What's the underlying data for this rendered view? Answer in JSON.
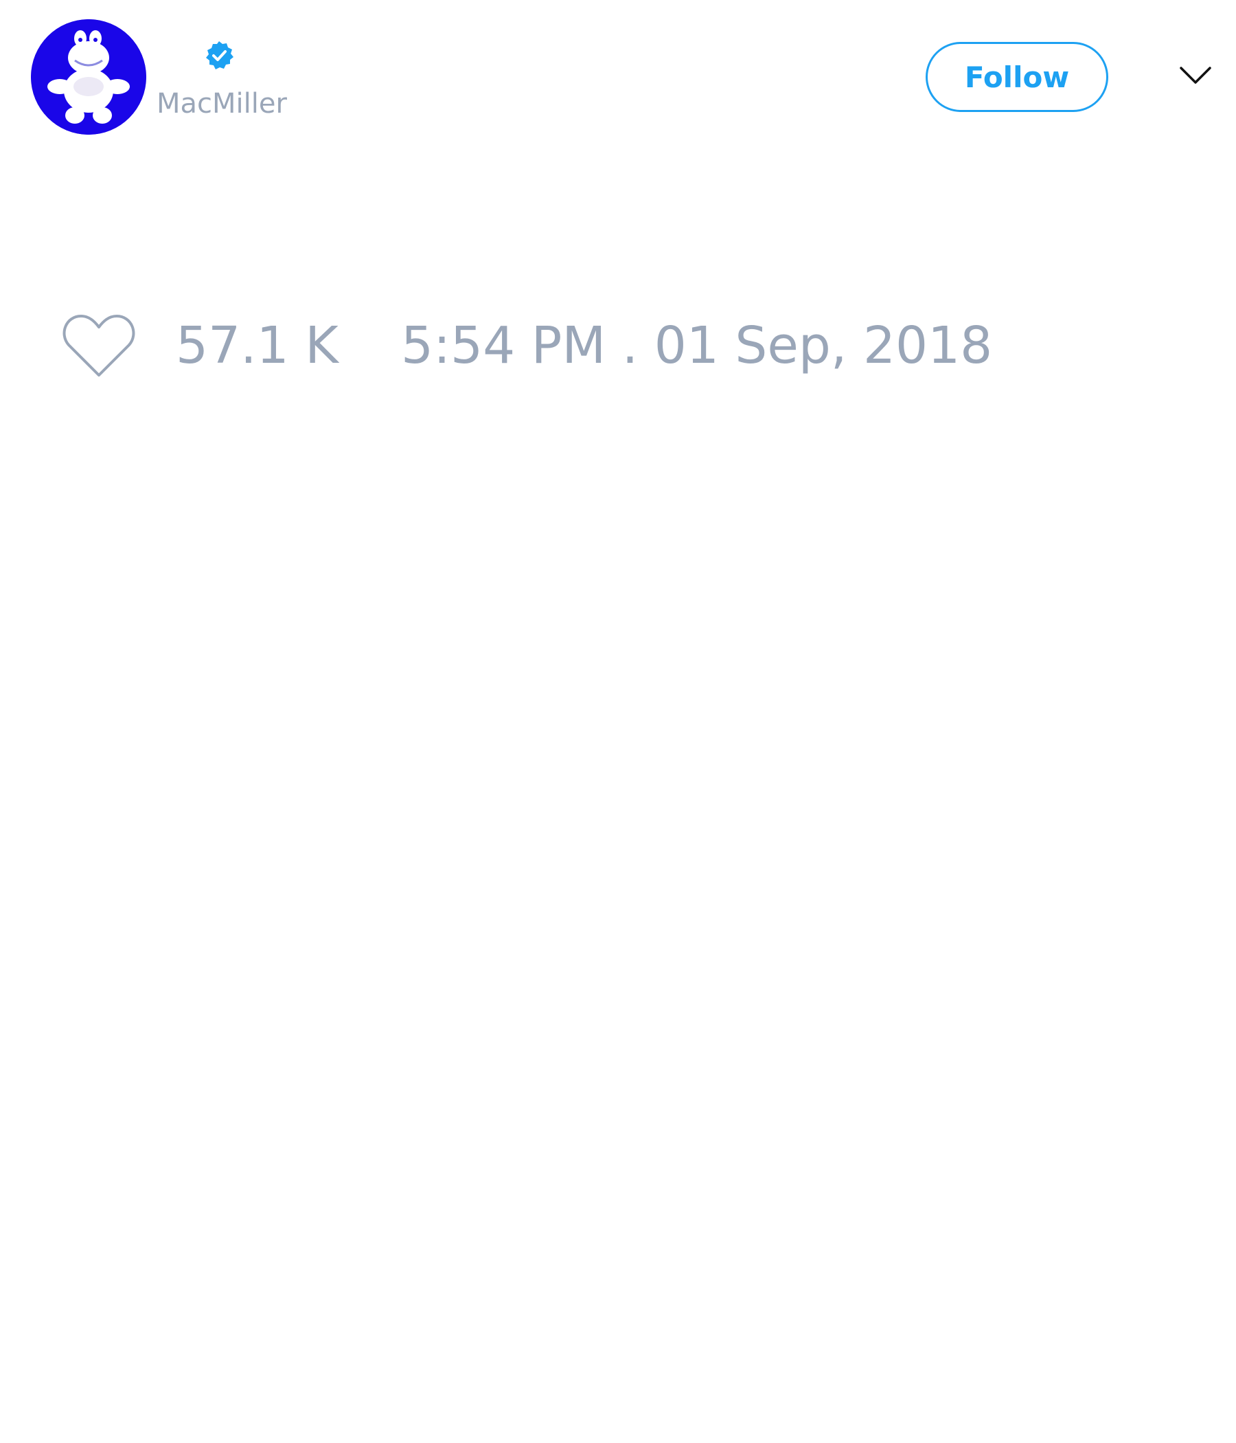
{
  "tweet": {
    "author": {
      "handle": "MacMiller",
      "verified": true,
      "avatar_icon": "cartoon-mascot-avatar",
      "avatar_bg": "#1a06e8"
    },
    "follow_label": "Follow",
    "menu_icon": "chevron-down-icon",
    "likes": "57.1 K",
    "timestamp": "5:54 PM . 01 Sep, 2018"
  },
  "colors": {
    "accent": "#1da1f2",
    "muted_text": "#9aa6b8",
    "background": "#ffffff"
  }
}
